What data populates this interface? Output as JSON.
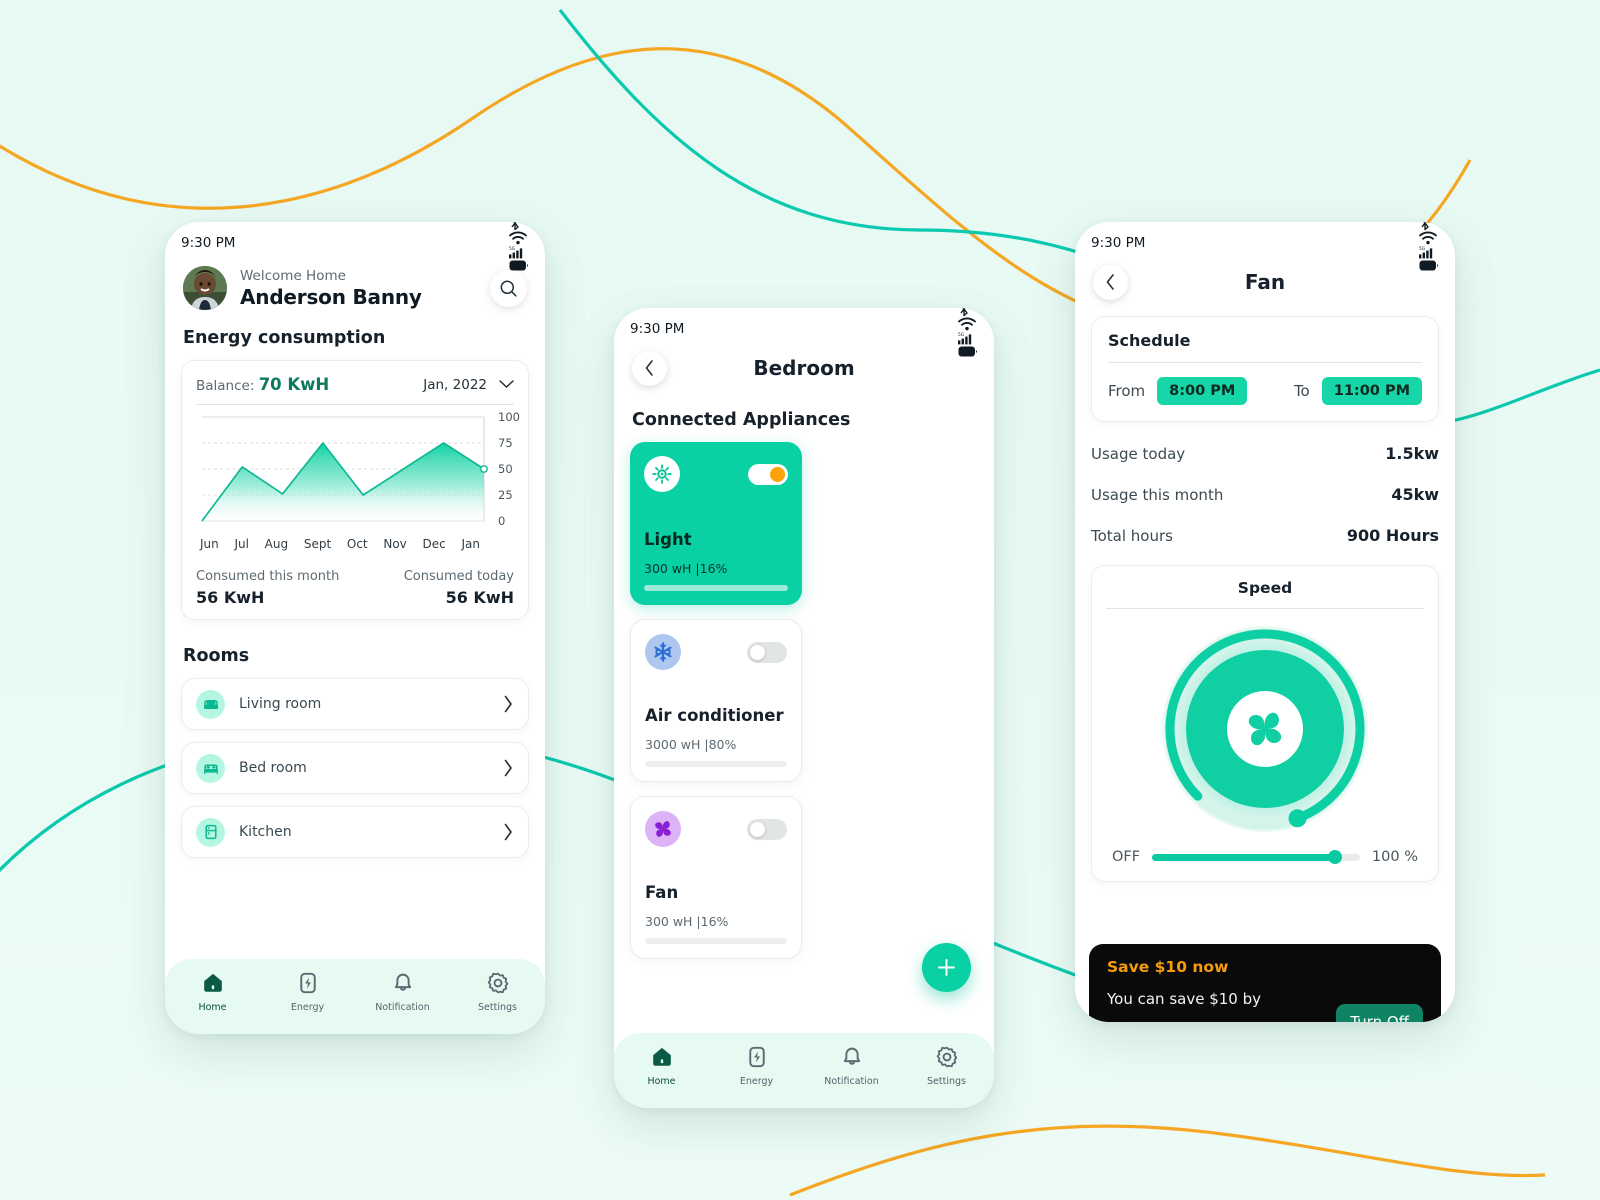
{
  "theme": {
    "background": "#e9faf4",
    "primary": "#0ad1a3",
    "primary_dark": "#0e7a5d",
    "accent_orange": "#fda20a",
    "curve_orange": "#f5a623",
    "curve_teal": "#0bc9ae"
  },
  "status_bar": {
    "time": "9:30 PM",
    "icons": [
      "bluetooth-icon",
      "wifi-icon",
      "signal-5g-icon",
      "battery-icon"
    ]
  },
  "home": {
    "welcome": "Welcome Home",
    "user_name": "Anderson Banny",
    "search_icon": "search-icon",
    "energy_title": "Energy consumption",
    "balance_label": "Balance:",
    "balance_value": "70 KwH",
    "period": "Jan, 2022",
    "period_caret": "chevron-down-icon",
    "consumed_month_label": "Consumed this month",
    "consumed_month_value": "56 KwH",
    "consumed_today_label": "Consumed today",
    "consumed_today_value": "56 KwH",
    "rooms_title": "Rooms",
    "rooms": [
      {
        "name": "Living room",
        "icon": "sofa-icon"
      },
      {
        "name": "Bed room",
        "icon": "bed-icon"
      },
      {
        "name": "Kitchen",
        "icon": "fridge-icon"
      }
    ]
  },
  "chart_data": {
    "type": "area",
    "title": "Energy consumption",
    "categories": [
      "Jun",
      "Jul",
      "Aug",
      "Sept",
      "Oct",
      "Nov",
      "Dec",
      "Jan"
    ],
    "values": [
      0,
      52,
      26,
      75,
      25,
      50,
      75,
      50
    ],
    "ylim": [
      0,
      100
    ],
    "yticks": [
      0,
      25,
      50,
      75,
      100
    ],
    "ytick_labels": [
      "0",
      "25",
      "50",
      "75",
      "100"
    ],
    "xlabel": "",
    "ylabel": "",
    "grid": true,
    "series_color": "#0ad1a3",
    "last_point_marker": true
  },
  "bottom_nav": {
    "items": [
      {
        "label": "Home",
        "icon": "home-icon",
        "active": true
      },
      {
        "label": "Energy",
        "icon": "bolt-icon",
        "active": false
      },
      {
        "label": "Notification",
        "icon": "bell-icon",
        "active": false
      },
      {
        "label": "Settings",
        "icon": "gear-icon",
        "active": false
      }
    ]
  },
  "room": {
    "back_icon": "chevron-left-icon",
    "title": "Bedroom",
    "section_title": "Connected Appliances",
    "add_icon": "plus-icon",
    "appliances": [
      {
        "name": "Light",
        "icon": "sun-icon",
        "state": "on",
        "meta": "300 wH  |16%",
        "percent": 16
      },
      {
        "name": "Air conditioner",
        "icon": "snowflake-icon",
        "state": "off",
        "meta": "3000 wH  |80%",
        "percent": 80
      },
      {
        "name": "Fan",
        "icon": "fan-icon",
        "state": "off",
        "meta": "300 wH  |16%",
        "percent": 16
      }
    ]
  },
  "device": {
    "back_icon": "chevron-left-icon",
    "title": "Fan",
    "schedule": {
      "title": "Schedule",
      "from_label": "From",
      "from_value": "8:00 PM",
      "to_label": "To",
      "to_value": "11:00 PM"
    },
    "stats": [
      {
        "label": "Usage today",
        "value": "1.5kw"
      },
      {
        "label": "Usage this month",
        "value": "45kw"
      },
      {
        "label": "Total hours",
        "value": "900 Hours"
      }
    ],
    "speed": {
      "title": "Speed",
      "dial_icon": "fan-icon",
      "dial_percent": 100,
      "min_label": "OFF",
      "max_label": "100 %",
      "slider_percent": 88
    },
    "promo": {
      "headline": "Save $10  now",
      "subline": "You can save  $10 by",
      "button": "Turn Off"
    }
  }
}
